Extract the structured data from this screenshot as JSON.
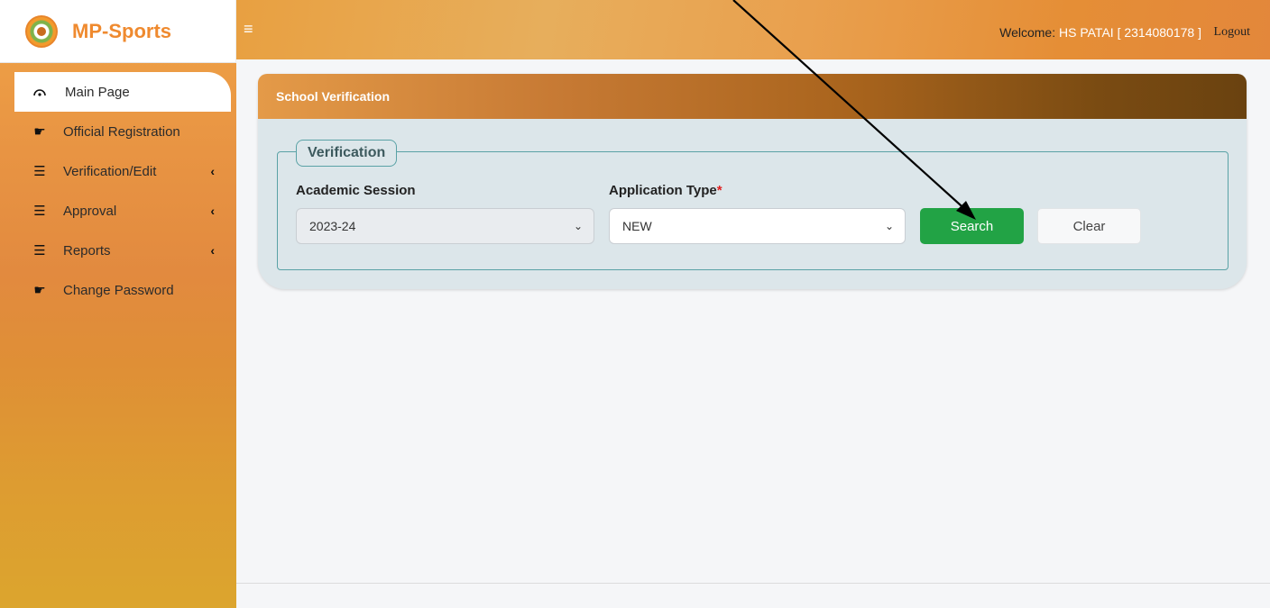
{
  "app": {
    "name": "MP-Sports"
  },
  "sidebar": {
    "items": [
      {
        "label": "Main Page",
        "icon": "dashboard-icon",
        "active": true
      },
      {
        "label": "Official Registration",
        "icon": "hand-point-right-icon"
      },
      {
        "label": "Verification/Edit",
        "icon": "list-icon",
        "has_submenu": true
      },
      {
        "label": "Approval",
        "icon": "list-icon",
        "has_submenu": true
      },
      {
        "label": "Reports",
        "icon": "list-icon",
        "has_submenu": true
      },
      {
        "label": "Change Password",
        "icon": "hand-point-right-icon"
      }
    ]
  },
  "topbar": {
    "menu_icon": "hamburger-icon",
    "welcome_label": "Welcome:",
    "user": "HS PATAI [ 2314080178 ]",
    "logout_label": "Logout"
  },
  "card": {
    "title": "School Verification",
    "legend": "Verification",
    "fields": {
      "academic_session": {
        "label": "Academic Session",
        "value": "2023-24"
      },
      "application_type": {
        "label": "Application Type",
        "required_mark": "*",
        "value": "NEW"
      }
    },
    "buttons": {
      "search": "Search",
      "clear": "Clear"
    }
  },
  "colors": {
    "brand_orange": "#ef8a2f",
    "search_green": "#22a345",
    "required_red": "#e02020"
  }
}
